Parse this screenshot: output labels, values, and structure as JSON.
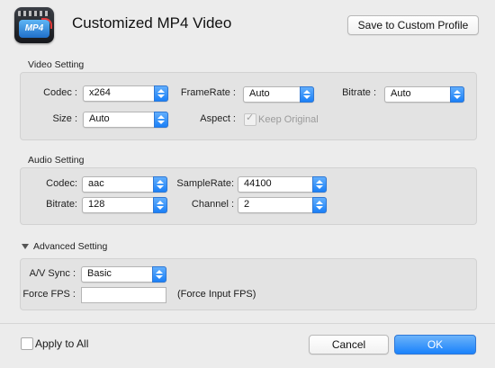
{
  "header": {
    "app_icon_text": "MP4",
    "title": "Customized MP4 Video",
    "save_profile_label": "Save to Custom Profile"
  },
  "video": {
    "section_title": "Video Setting",
    "codec_label": "Codec :",
    "codec_value": "x264",
    "framerate_label": "FrameRate :",
    "framerate_value": "Auto",
    "bitrate_label": "Bitrate :",
    "bitrate_value": "Auto",
    "size_label": "Size :",
    "size_value": "Auto",
    "aspect_label": "Aspect :",
    "keep_original_label": "Keep Original"
  },
  "audio": {
    "section_title": "Audio Setting",
    "codec_label": "Codec:",
    "codec_value": "aac",
    "samplerate_label": "SampleRate:",
    "samplerate_value": "44100",
    "bitrate_label": "Bitrate:",
    "bitrate_value": "128",
    "channel_label": "Channel :",
    "channel_value": "2"
  },
  "advanced": {
    "section_title": "Advanced Setting",
    "av_sync_label": "A/V Sync :",
    "av_sync_value": "Basic",
    "force_fps_label": "Force FPS :",
    "force_fps_value": "",
    "force_fps_hint": "(Force Input FPS)"
  },
  "footer": {
    "apply_all_label": "Apply to All",
    "cancel_label": "Cancel",
    "ok_label": "OK"
  },
  "colors": {
    "accent": "#1a82fb",
    "background": "#ececec",
    "group_background": "#e3e3e3"
  }
}
